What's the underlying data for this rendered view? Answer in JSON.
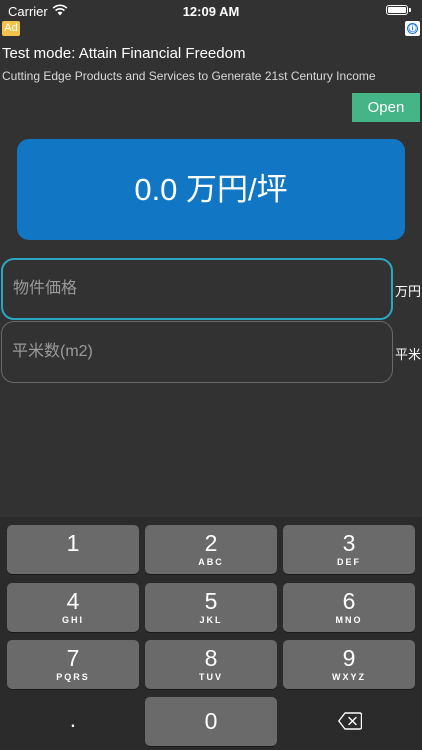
{
  "status": {
    "carrier": "Carrier",
    "time": "12:09 AM"
  },
  "ad": {
    "badge": "Ad",
    "info_icon": "ⓘ",
    "title": "Test mode: Attain Financial Freedom",
    "subtitle": "Cutting Edge Products and Services to Generate 21st Century Income",
    "open_label": "Open"
  },
  "result": {
    "text": "0.0 万円/坪"
  },
  "inputs": {
    "price_placeholder": "物件価格",
    "price_value": "",
    "price_unit": "万円",
    "area_placeholder": "平米数(m2)",
    "area_value": "",
    "area_unit": "平米"
  },
  "keyboard": {
    "keys": [
      {
        "digit": "1",
        "letters": ""
      },
      {
        "digit": "2",
        "letters": "ABC"
      },
      {
        "digit": "3",
        "letters": "DEF"
      },
      {
        "digit": "4",
        "letters": "GHI"
      },
      {
        "digit": "5",
        "letters": "JKL"
      },
      {
        "digit": "6",
        "letters": "MNO"
      },
      {
        "digit": "7",
        "letters": "PQRS"
      },
      {
        "digit": "8",
        "letters": "TUV"
      },
      {
        "digit": "9",
        "letters": "WXYZ"
      },
      {
        "digit": ".",
        "letters": ""
      },
      {
        "digit": "0",
        "letters": ""
      }
    ]
  },
  "colors": {
    "background": "#323232",
    "result_bg": "#1177c5",
    "open_button": "#45b487",
    "ad_badge": "#f6c34a",
    "focus_border": "#2aa6c0"
  }
}
